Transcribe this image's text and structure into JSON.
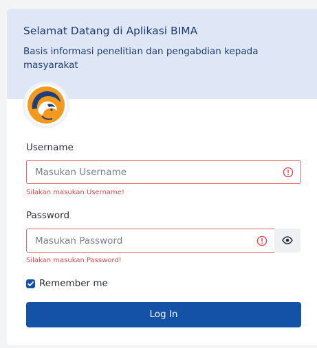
{
  "header": {
    "title": "Selamat Datang di Aplikasi BIMA",
    "subtitle": "Basis informasi penelitian dan pengabdian kepada masyarakat"
  },
  "form": {
    "username": {
      "label": "Username",
      "placeholder": "Masukan Username",
      "value": "",
      "error": "Silakan masukan Username!"
    },
    "password": {
      "label": "Password",
      "placeholder": "Masukan Password",
      "value": "",
      "error": "Silakan masukan Password!"
    },
    "remember": {
      "label": "Remember me",
      "checked": true
    },
    "submit_label": "Log In"
  },
  "colors": {
    "header_bg": "#dfe6f5",
    "primary": "#1452a8",
    "error": "#e2484d",
    "logo_orange": "#f39a1e"
  },
  "icons": [
    "app-logo-icon",
    "error-icon",
    "eye-icon",
    "check-icon"
  ]
}
